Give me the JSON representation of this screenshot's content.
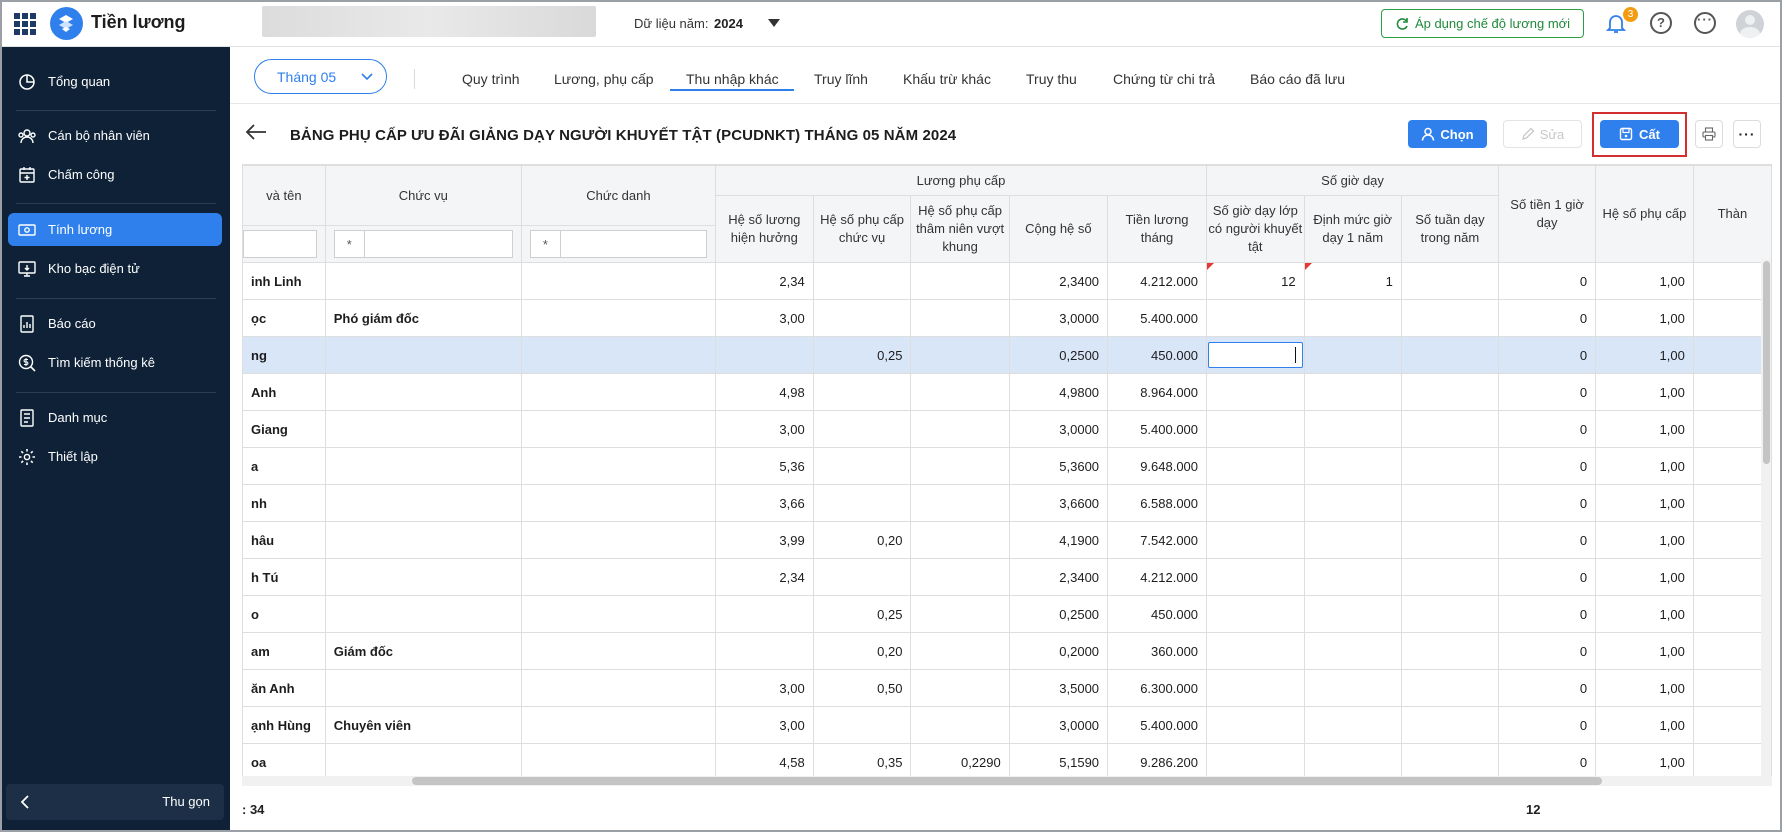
{
  "app": {
    "name": "Tiền lương"
  },
  "topbar": {
    "year_label": "Dữ liệu năm:",
    "year_value": "2024",
    "apply_button": "Áp dụng chế độ lương mới",
    "notification_count": "3",
    "help_glyph": "?",
    "more_glyph": "···"
  },
  "sidebar": {
    "items": [
      {
        "label": "Tổng quan",
        "icon": "pie-chart-icon"
      },
      {
        "label": "Cán bộ nhân viên",
        "icon": "people-icon"
      },
      {
        "label": "Chấm công",
        "icon": "calendar-icon"
      },
      {
        "label": "Tính lương",
        "icon": "money-icon",
        "active": true
      },
      {
        "label": "Kho bạc điện tử",
        "icon": "monitor-icon"
      },
      {
        "label": "Báo cáo",
        "icon": "report-icon"
      },
      {
        "label": "Tìm kiếm thống kê",
        "icon": "search-dollar-icon"
      },
      {
        "label": "Danh mục",
        "icon": "list-icon"
      },
      {
        "label": "Thiết lập",
        "icon": "gear-icon"
      }
    ],
    "collapse_label": "Thu gọn"
  },
  "tabs": {
    "month": "Tháng 05",
    "items": [
      "Quy trình",
      "Lương, phụ cấp",
      "Thu nhập khác",
      "Truy lĩnh",
      "Khấu trừ khác",
      "Truy thu",
      "Chứng từ chi trả",
      "Báo cáo đã lưu"
    ],
    "active_index": 2
  },
  "toolbar": {
    "title": "BẢNG PHỤ CẤP ƯU ĐÃI GIẢNG DẠY NGƯỜI KHUYẾT TẬT (PCUDNKT) THÁNG 05 NĂM 2024",
    "choose": "Chọn",
    "edit": "Sửa",
    "save": "Cất"
  },
  "table": {
    "group_headers": {
      "salary": "Lương phụ cấp",
      "hours": "Số giờ dạy"
    },
    "headers": {
      "name": "và tên",
      "position": "Chức vụ",
      "title": "Chức danh",
      "coef_salary": "Hệ số lương hiện hưởng",
      "coef_position": "Hệ số phụ cấp chức vụ",
      "coef_seniority": "Hệ số phụ cấp thâm niên vượt khung",
      "coef_total": "Cộng hệ số",
      "monthly_salary": "Tiền lương tháng",
      "hours_disabled": "Số giờ dạy lớp có người khuyết tật",
      "hours_quota": "Định mức giờ dạy 1 năm",
      "weeks": "Số tuần dạy trong năm",
      "money_per_hour": "Số tiền 1 giờ dạy",
      "coef_allowance": "Hệ số phụ cấp",
      "last": "Thàn"
    },
    "filter_star": "*",
    "rows": [
      [
        "inh Linh",
        "",
        "",
        "2,34",
        "",
        "",
        "2,3400",
        "4.212.000",
        "12",
        "1",
        "",
        "0",
        "1,00",
        ""
      ],
      [
        "ọc",
        "Phó giám đốc",
        "",
        "3,00",
        "",
        "",
        "3,0000",
        "5.400.000",
        "",
        "",
        "",
        "0",
        "1,00",
        ""
      ],
      [
        "ng",
        "",
        "",
        "",
        "0,25",
        "",
        "0,2500",
        "450.000",
        "",
        "",
        "",
        "0",
        "1,00",
        ""
      ],
      [
        "Anh",
        "",
        "",
        "4,98",
        "",
        "",
        "4,9800",
        "8.964.000",
        "",
        "",
        "",
        "0",
        "1,00",
        ""
      ],
      [
        "Giang",
        "",
        "",
        "3,00",
        "",
        "",
        "3,0000",
        "5.400.000",
        "",
        "",
        "",
        "0",
        "1,00",
        ""
      ],
      [
        "a",
        "",
        "",
        "5,36",
        "",
        "",
        "5,3600",
        "9.648.000",
        "",
        "",
        "",
        "0",
        "1,00",
        ""
      ],
      [
        "nh",
        "",
        "",
        "3,66",
        "",
        "",
        "3,6600",
        "6.588.000",
        "",
        "",
        "",
        "0",
        "1,00",
        ""
      ],
      [
        "hâu",
        "",
        "",
        "3,99",
        "0,20",
        "",
        "4,1900",
        "7.542.000",
        "",
        "",
        "",
        "0",
        "1,00",
        ""
      ],
      [
        "h Tú",
        "",
        "",
        "2,34",
        "",
        "",
        "2,3400",
        "4.212.000",
        "",
        "",
        "",
        "0",
        "1,00",
        ""
      ],
      [
        "o",
        "",
        "",
        "",
        "0,25",
        "",
        "0,2500",
        "450.000",
        "",
        "",
        "",
        "0",
        "1,00",
        ""
      ],
      [
        "am",
        "Giám đốc",
        "",
        "",
        "0,20",
        "",
        "0,2000",
        "360.000",
        "",
        "",
        "",
        "0",
        "1,00",
        ""
      ],
      [
        "ăn Anh",
        "",
        "",
        "3,00",
        "0,50",
        "",
        "3,5000",
        "6.300.000",
        "",
        "",
        "",
        "0",
        "1,00",
        ""
      ],
      [
        "ạnh Hùng",
        "Chuyên viên",
        "",
        "3,00",
        "",
        "",
        "3,0000",
        "5.400.000",
        "",
        "",
        "",
        "0",
        "1,00",
        ""
      ],
      [
        "oa",
        "",
        "",
        "4,58",
        "0,35",
        "0,2290",
        "5,1590",
        "9.286.200",
        "",
        "",
        "",
        "0",
        "1,00",
        ""
      ]
    ],
    "selected_row": 2,
    "footer_count": ": 34",
    "footer_hours_total": "12"
  },
  "colors": {
    "accent": "#2f80ed",
    "sidebar": "#0e2137",
    "highlight": "#d32f2f",
    "apply_green": "#1f8a3a"
  }
}
